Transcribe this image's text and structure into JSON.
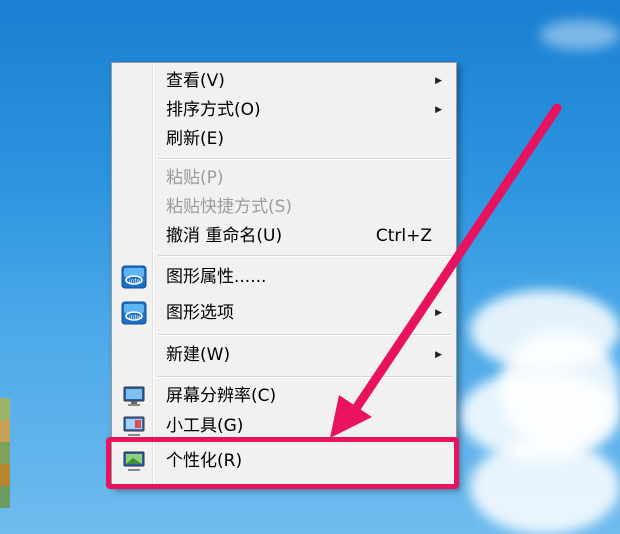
{
  "menu": {
    "items": [
      {
        "label": "查看(V)",
        "submenu": true
      },
      {
        "label": "排序方式(O)",
        "submenu": true
      },
      {
        "label": "刷新(E)"
      },
      {
        "label": "粘贴(P)",
        "disabled": true
      },
      {
        "label": "粘贴快捷方式(S)",
        "disabled": true
      },
      {
        "label": "撤消 重命名(U)",
        "shortcut": "Ctrl+Z"
      },
      {
        "label": "图形属性......",
        "icon": "intel-graphics-icon"
      },
      {
        "label": "图形选项",
        "icon": "intel-graphics-icon",
        "submenu": true
      },
      {
        "label": "新建(W)",
        "submenu": true
      },
      {
        "label": "屏幕分辨率(C)",
        "icon": "monitor-icon"
      },
      {
        "label": "小工具(G)",
        "icon": "gadgets-icon"
      },
      {
        "label": "个性化(R)",
        "icon": "personalize-icon",
        "highlighted": true
      }
    ]
  },
  "colors": {
    "annotation": "#e8125f",
    "menu_bg": "#f1f1f1",
    "desktop": "#2d95e0"
  }
}
